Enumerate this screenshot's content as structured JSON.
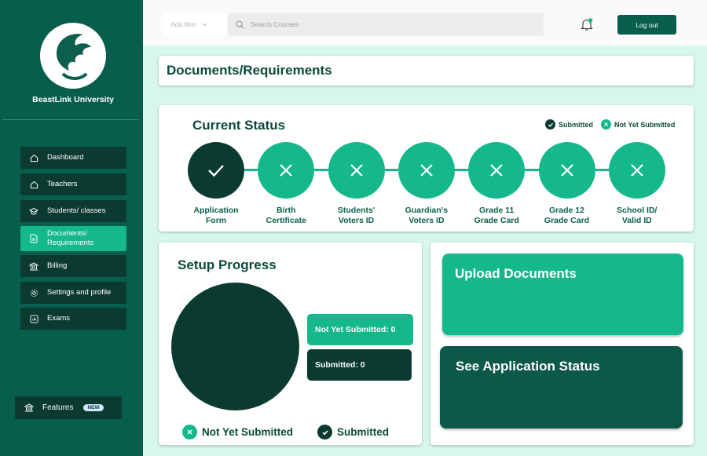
{
  "sidebar": {
    "university_name": "BeastLink University",
    "items": [
      {
        "label": "Dashboard",
        "icon": "home-icon"
      },
      {
        "label": "Teachers",
        "icon": "home-icon"
      },
      {
        "label": "Students/ classes",
        "icon": "graduation-cap-icon"
      },
      {
        "label": "Documents/\nRequirements",
        "icon": "document-icon",
        "active": true
      },
      {
        "label": "Billing",
        "icon": "bank-icon"
      },
      {
        "label": "Settings and profile",
        "icon": "gear-icon"
      },
      {
        "label": "Exams",
        "icon": "chart-icon"
      }
    ],
    "features": {
      "label": "Features",
      "badge": "NEW"
    }
  },
  "topbar": {
    "filter_placeholder": "Add filter",
    "search_placeholder": "Search Courses",
    "logout_label": "Log out"
  },
  "page": {
    "title": "Documents/Requirements"
  },
  "status": {
    "title": "Current Status",
    "legend_submitted": "Submitted",
    "legend_not_submitted": "Not Yet Submitted",
    "steps": [
      {
        "label": "Application\nForm",
        "submitted": true
      },
      {
        "label": "Birth\nCertificate",
        "submitted": false
      },
      {
        "label": "Students'\nVoters ID",
        "submitted": false
      },
      {
        "label": "Guardian's\nVoters ID",
        "submitted": false
      },
      {
        "label": "Grade 11\nGrade Card",
        "submitted": false
      },
      {
        "label": "Grade 12\nGrade Card",
        "submitted": false
      },
      {
        "label": "School ID/\nValid ID",
        "submitted": false
      }
    ]
  },
  "progress": {
    "title": "Setup Progress",
    "not_yet_label": "Not Yet Submitted: 0",
    "submitted_label": "Submitted: 0",
    "legend_not_submitted": "Not Yet Submitted",
    "legend_submitted": "Submitted"
  },
  "actions": {
    "upload_label": "Upload Documents",
    "see_status_label": "See Application Status"
  },
  "colors": {
    "sidebar": "#085e4c",
    "accent": "#14b88b",
    "dark": "#0b3a31",
    "background": "#d6f6ee"
  }
}
